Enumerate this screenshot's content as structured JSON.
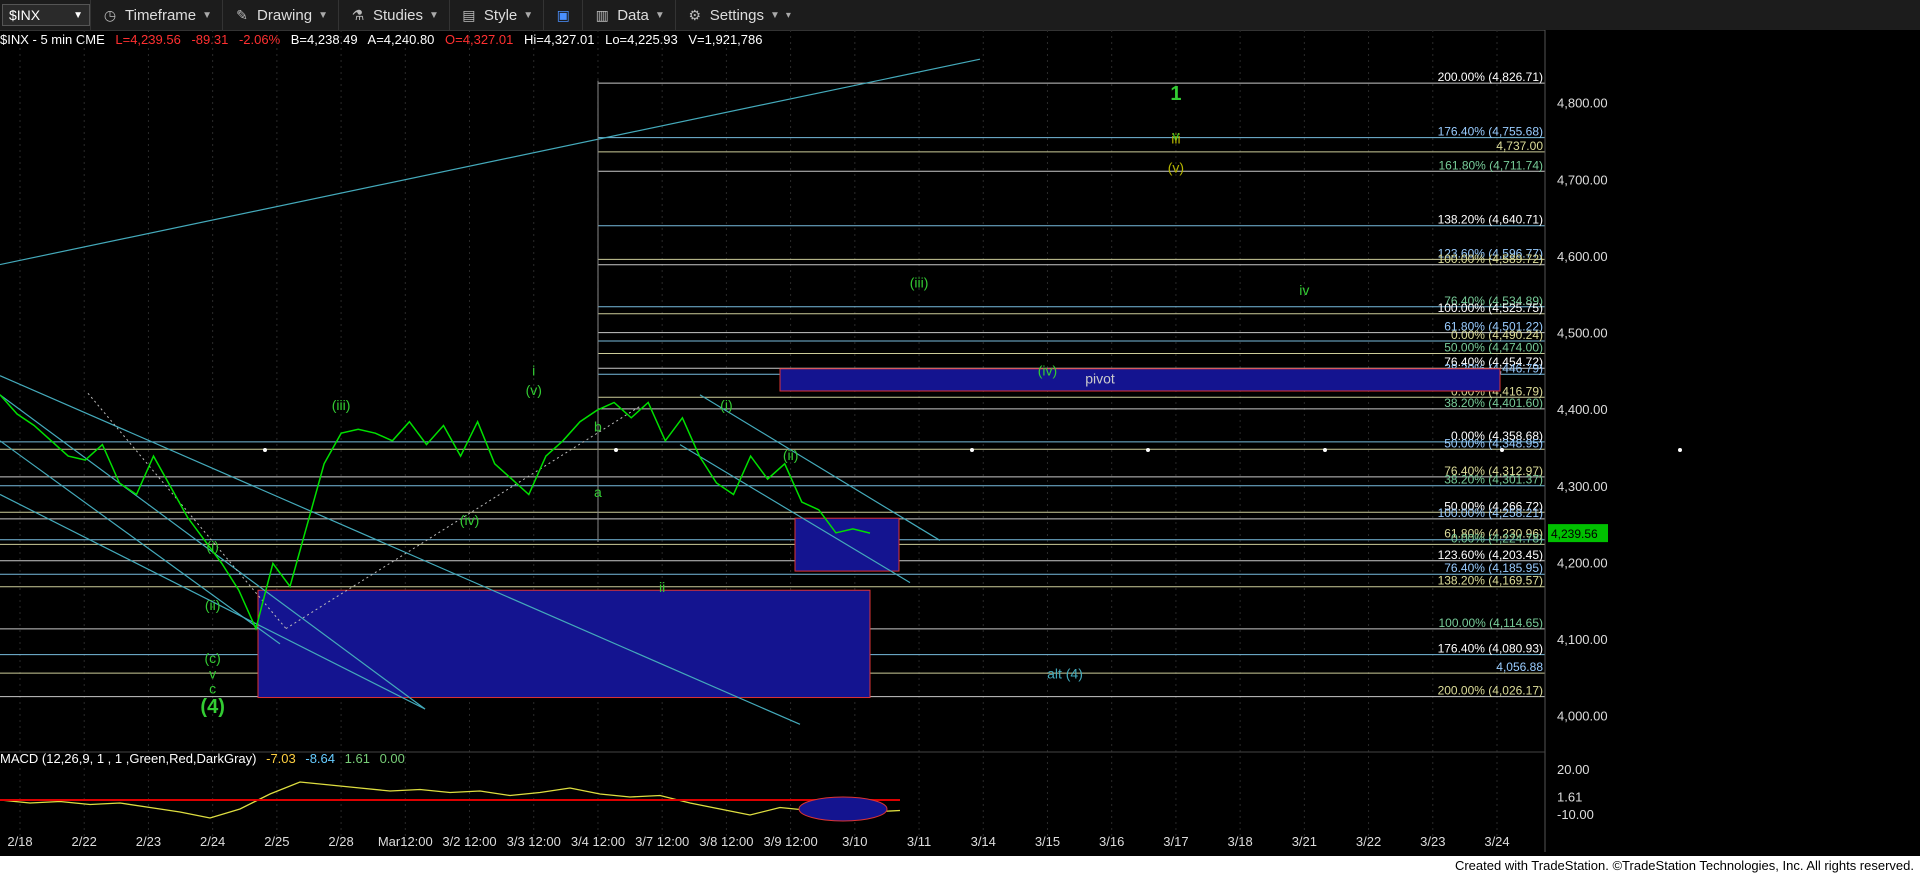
{
  "toolbar": {
    "symbol": "$INX",
    "timeframe": "Timeframe",
    "drawing": "Drawing",
    "studies": "Studies",
    "style": "Style",
    "data": "Data",
    "settings": "Settings"
  },
  "info": {
    "name": "$INX - 5 min CME",
    "last": "L=4,239.56",
    "chg": "-89.31",
    "pct": "-2.06%",
    "bid": "B=4,238.49",
    "ask": "A=4,240.80",
    "open": "O=4,327.01",
    "hi": "Hi=4,327.01",
    "lo": "Lo=4,225.93",
    "vol": "V=1,921,786"
  },
  "macd": {
    "label": "MACD (12,26,9, 1 , 1 ,Green,Red,DarkGray)",
    "v1": "-7.03",
    "v2": "-8.64",
    "v3": "1.61",
    "v4": "0.00"
  },
  "footer": "Created with TradeStation. ©TradeStation Technologies, Inc. All rights reserved.",
  "colors": {
    "up": "#00e000",
    "down": "#ff3030",
    "wave": "#00c000",
    "fib": "#9fd",
    "box": "#1a1a9a",
    "cyan": "#4ab"
  },
  "chart_data": {
    "type": "line",
    "title": "",
    "y_ticks": [
      "4,800.00",
      "4,700.00",
      "4,600.00",
      "4,500.00",
      "4,400.00",
      "4,300.00",
      "4,200.00",
      "4,100.00",
      "4,000.00"
    ],
    "ylim": [
      3950,
      4870
    ],
    "x_ticks": [
      "2/18",
      "2/22",
      "2/23",
      "2/24",
      "2/25",
      "2/28",
      "Mar12:00",
      "3/2 12:00",
      "3/3 12:00",
      "3/4 12:00",
      "3/7 12:00",
      "3/8 12:00",
      "3/9 12:00",
      "3/10",
      "3/11",
      "3/14",
      "3/15",
      "3/16",
      "3/17",
      "3/18",
      "3/21",
      "3/22",
      "3/23",
      "3/24"
    ],
    "last_price": "4,239.56",
    "price_series": [
      4420,
      4395,
      4380,
      4360,
      4340,
      4335,
      4355,
      4305,
      4290,
      4340,
      4300,
      4260,
      4230,
      4200,
      4165,
      4115,
      4200,
      4170,
      4250,
      4330,
      4370,
      4375,
      4370,
      4360,
      4385,
      4355,
      4380,
      4340,
      4385,
      4330,
      4310,
      4290,
      4340,
      4360,
      4385,
      4400,
      4410,
      4390,
      4410,
      4360,
      4390,
      4340,
      4305,
      4290,
      4340,
      4310,
      4330,
      4280,
      4270,
      4240,
      4245,
      4239.56
    ],
    "fib_levels": [
      {
        "label": "200.00% (4,826.71)",
        "value": 4826.71
      },
      {
        "label": "176.40% (4,755.68)",
        "value": 4755.68
      },
      {
        "label": "4,737.00",
        "value": 4737
      },
      {
        "label": "161.80% (4,711.74)",
        "value": 4711.74
      },
      {
        "label": "138.20% (4,640.71)",
        "value": 4640.71
      },
      {
        "label": "123.60% (4,596.77)",
        "value": 4596.77
      },
      {
        "label": "100.00% (4,589.72)",
        "value": 4589.72
      },
      {
        "label": "76.40% (4,534.89)",
        "value": 4534.89
      },
      {
        "label": "100.00% (4,525.75)",
        "value": 4525.75
      },
      {
        "label": "61.80% (4,501.22)",
        "value": 4501.22
      },
      {
        "label": "0.00% (4,490.24)",
        "value": 4490.24
      },
      {
        "label": "50.00% (4,474.00)",
        "value": 4474
      },
      {
        "label": "76.40% (4,454.72)",
        "value": 4454.72
      },
      {
        "label": "38.20% (4,446.79)",
        "value": 4446.79
      },
      {
        "label": "0.00% (4,416.79)",
        "value": 4416.79
      },
      {
        "label": "38.20% (4,401.60)",
        "value": 4401.6
      },
      {
        "label": "0.00% (4,358.68)",
        "value": 4358.68
      },
      {
        "label": "50.00% (4,348.95)",
        "value": 4348.95
      },
      {
        "label": "76.40% (4,312.97)",
        "value": 4312.97
      },
      {
        "label": "38.20% (4,301.37)",
        "value": 4301.37
      },
      {
        "label": "50.00% (4,266.72)",
        "value": 4266.72
      },
      {
        "label": "100.00% (4,258.21)",
        "value": 4258.21
      },
      {
        "label": "61.80% (4,230.96)",
        "value": 4230.96
      },
      {
        "label": "0.00% (4,224.78)",
        "value": 4224.78
      },
      {
        "label": "123.60% (4,203.45)",
        "value": 4203.45
      },
      {
        "label": "76.40% (4,185.95)",
        "value": 4185.95
      },
      {
        "label": "138.20% (4,169.57)",
        "value": 4169.57
      },
      {
        "label": "100.00% (4,114.65)",
        "value": 4114.65
      },
      {
        "label": "176.40% (4,080.93)",
        "value": 4080.93
      },
      {
        "label": "4,056.88",
        "value": 4056.88
      },
      {
        "label": "200.00% (4,026.17)",
        "value": 4026.17
      }
    ],
    "wave_labels": [
      {
        "text": "1",
        "x": "3/17",
        "y": 4805
      },
      {
        "text": "v",
        "x": "3/17",
        "y": 4752
      },
      {
        "text": "iii",
        "x": "3/17",
        "y": 4748
      },
      {
        "text": "(v)",
        "x": "3/17",
        "y": 4710
      },
      {
        "text": "(iii)",
        "x": "3/11",
        "y": 4560
      },
      {
        "text": "iv",
        "x": "3/21",
        "y": 4550
      },
      {
        "text": "(iv)",
        "x": "3/15",
        "y": 4445
      },
      {
        "text": "i",
        "x": "3/3 12:00",
        "y": 4445
      },
      {
        "text": "(v)",
        "x": "3/3 12:00",
        "y": 4420
      },
      {
        "text": "(iii)",
        "x": "2/28",
        "y": 4400
      },
      {
        "text": "(i)",
        "x": "3/8 12:00",
        "y": 4400
      },
      {
        "text": "(ii)",
        "x": "3/9 12:00",
        "y": 4335
      },
      {
        "text": "b",
        "x": "3/4 12:00",
        "y": 4372
      },
      {
        "text": "a",
        "x": "3/4 12:00",
        "y": 4287
      },
      {
        "text": "(iv)",
        "x": "3/2 12:00",
        "y": 4250
      },
      {
        "text": "ii",
        "x": "3/7 12:00",
        "y": 4163
      },
      {
        "text": "(i)",
        "x": "2/24",
        "y": 4216
      },
      {
        "text": "(ii)",
        "x": "2/24",
        "y": 4139
      },
      {
        "text": "(c)",
        "x": "2/24",
        "y": 4070
      },
      {
        "text": "v",
        "x": "2/24",
        "y": 4050
      },
      {
        "text": "c",
        "x": "2/24",
        "y": 4030
      },
      {
        "text": "(4)",
        "x": "2/24",
        "y": 4005
      },
      {
        "text": "alt (4)",
        "x": "3/10",
        "y": 4050
      },
      {
        "text": "pivot",
        "x": "3/10",
        "y": 4435
      }
    ],
    "macd_ylim": [
      -20,
      20
    ],
    "macd_ticks": [
      "20.00",
      "1.61",
      "-10.00"
    ],
    "macd_series": [
      0,
      -2,
      -1,
      -3,
      -2,
      -5,
      -8,
      -12,
      -6,
      4,
      12,
      10,
      8,
      6,
      7,
      5,
      6,
      3,
      5,
      8,
      4,
      2,
      3,
      -2,
      -6,
      -10,
      -5,
      -7,
      -9,
      -8,
      -7
    ]
  }
}
